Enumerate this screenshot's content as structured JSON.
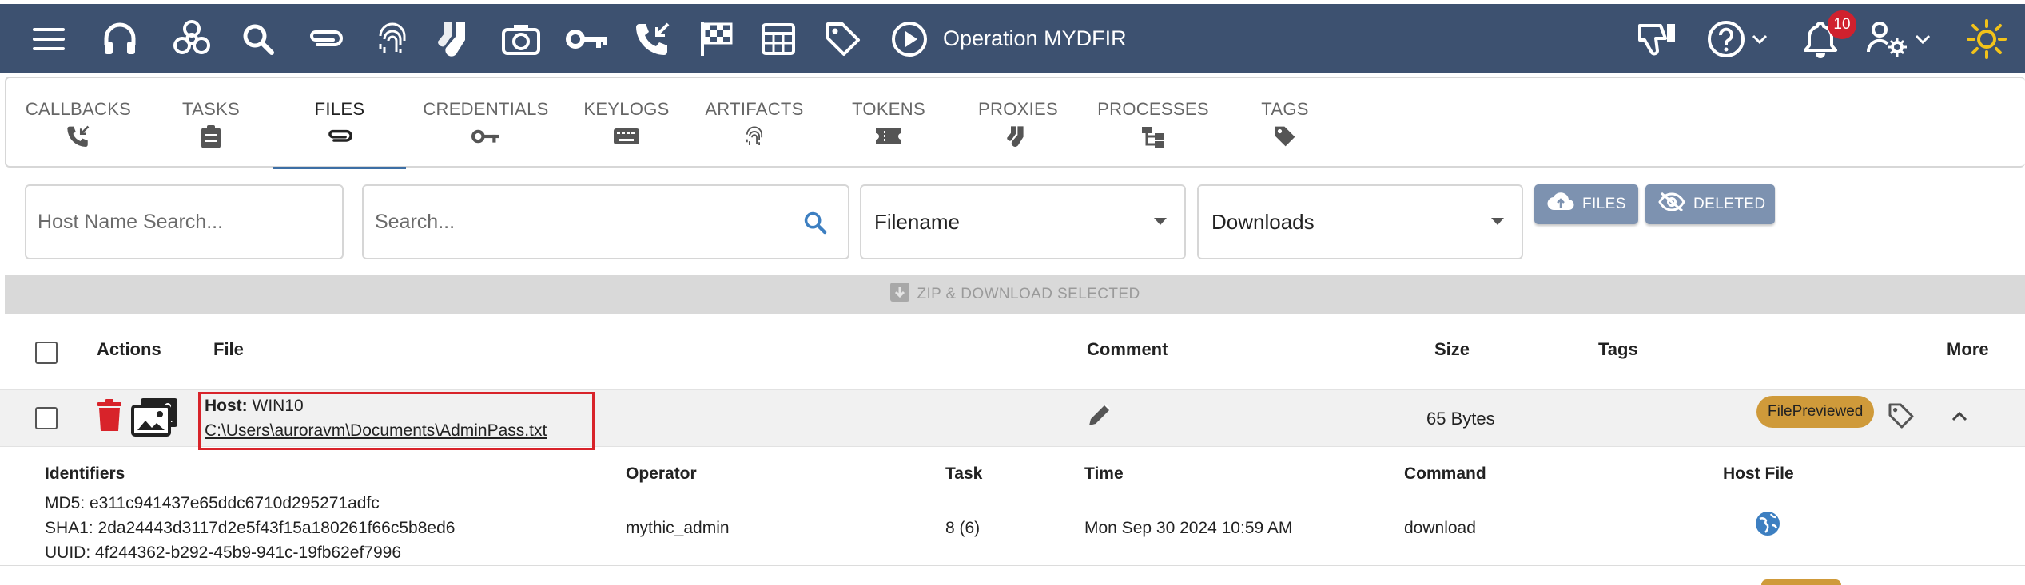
{
  "topbar": {
    "operation_label": "Operation MYDFIR",
    "notification_count": "10",
    "icons": [
      "menu-icon",
      "headphones-icon",
      "biohazard-icon",
      "search-icon",
      "paperclip-icon",
      "fingerprint-icon",
      "socks-icon",
      "camera-icon",
      "key-icon",
      "phone-callback-icon",
      "checkered-flag-icon",
      "table-icon",
      "tag-icon",
      "play-circle-icon",
      "thumbs-down-icon",
      "help-icon",
      "bell-icon",
      "user-settings-icon",
      "sun-icon"
    ],
    "bg_color": "#3d5170"
  },
  "tabs": [
    {
      "label": "CALLBACKS",
      "icon": "phone-callback-icon"
    },
    {
      "label": "TASKS",
      "icon": "clipboard-icon"
    },
    {
      "label": "FILES",
      "icon": "paperclip-icon",
      "active": true
    },
    {
      "label": "CREDENTIALS",
      "icon": "key-icon"
    },
    {
      "label": "KEYLOGS",
      "icon": "keyboard-icon"
    },
    {
      "label": "ARTIFACTS",
      "icon": "fingerprint-icon"
    },
    {
      "label": "TOKENS",
      "icon": "ticket-icon"
    },
    {
      "label": "PROXIES",
      "icon": "socks-icon"
    },
    {
      "label": "PROCESSES",
      "icon": "tree-icon"
    },
    {
      "label": "TAGS",
      "icon": "tag-icon"
    }
  ],
  "filters": {
    "host_placeholder": "Host Name Search...",
    "search_placeholder": "Search...",
    "field_select": "Filename",
    "type_select": "Downloads",
    "files_button": "FILES",
    "deleted_button": "DELETED"
  },
  "zip_button": "ZIP & DOWNLOAD SELECTED",
  "table": {
    "headers": {
      "actions": "Actions",
      "file": "File",
      "comment": "Comment",
      "size": "Size",
      "tags": "Tags",
      "more": "More"
    },
    "rows": [
      {
        "host_label": "Host:",
        "host": "WIN10",
        "path": "C:\\Users\\auroravm\\Documents\\AdminPass.txt",
        "size": "65 Bytes",
        "tag": "FilePreviewed"
      }
    ]
  },
  "details": {
    "headers": {
      "identifiers": "Identifiers",
      "operator": "Operator",
      "task": "Task",
      "time": "Time",
      "command": "Command",
      "host_file": "Host File"
    },
    "md5": "MD5: e311c941437e65ddc6710d295271adfc",
    "sha1": "SHA1: 2da24443d3117d2e5f43f15a180261f66c5b8ed6",
    "uuid": "UUID: 4f244362-b292-45b9-941c-19fb62ef7996",
    "operator": "mythic_admin",
    "task": "8 (6)",
    "time": "Mon Sep 30 2024 10:59 AM",
    "command": "download"
  },
  "colors": {
    "accent": "#3d6fa5",
    "delete": "#d8232a",
    "tag_pill": "#cf9a3a",
    "highlight_box": "#d8232a"
  }
}
